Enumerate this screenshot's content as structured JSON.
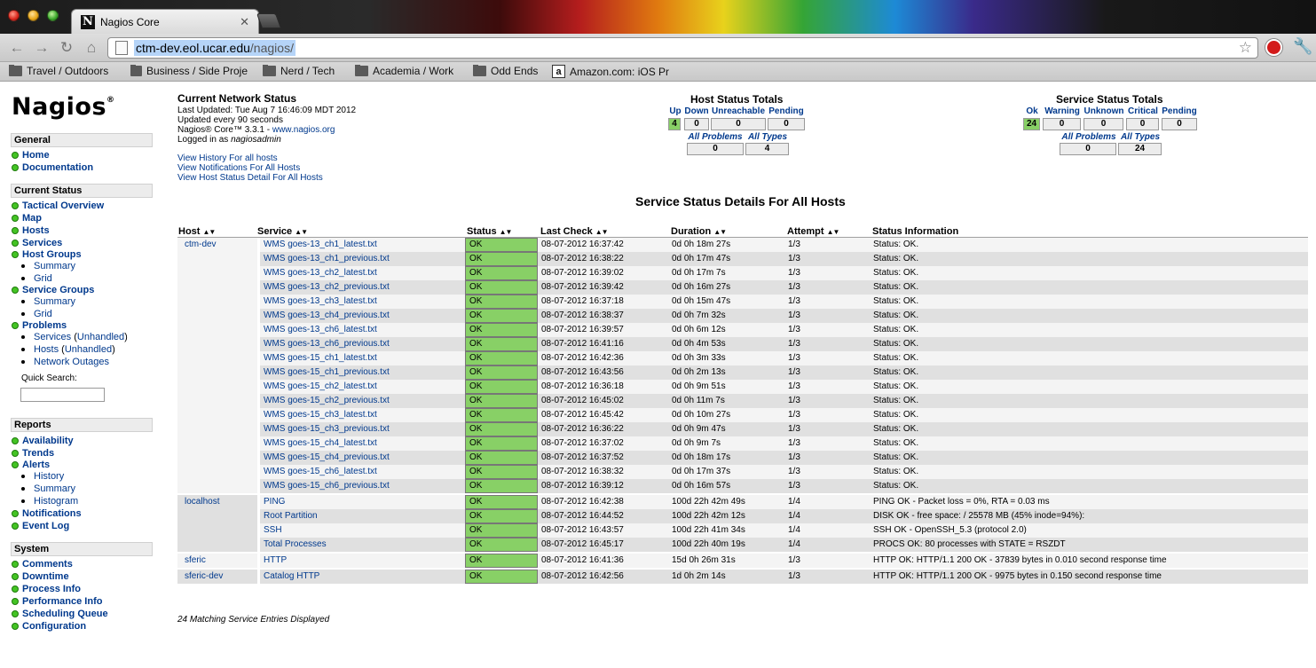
{
  "browser": {
    "tab_title": "Nagios Core",
    "tab_favicon": "N",
    "tab_close": "✕",
    "url_host": "ctm-dev.eol.ucar.edu",
    "url_path": "/nagios/",
    "bookmarks": [
      {
        "label": "Travel / Outdoors",
        "icon": "folder-icon"
      },
      {
        "label": "Business / Side Proje",
        "icon": "folder-icon"
      },
      {
        "label": "Nerd / Tech",
        "icon": "folder-icon"
      },
      {
        "label": "Academia / Work",
        "icon": "folder-icon"
      },
      {
        "label": "Odd Ends",
        "icon": "folder-icon"
      },
      {
        "label": "Amazon.com: iOS Pr",
        "icon": "amazon-icon"
      }
    ],
    "accent_colors": {
      "close": "#d8261c",
      "minimize": "#e6a414",
      "zoom": "#3aa62a"
    }
  },
  "logo": {
    "text": "Nagios",
    "mark": "®"
  },
  "sidebar": {
    "general": {
      "heading": "General",
      "items": [
        "Home",
        "Documentation"
      ]
    },
    "current_status": {
      "heading": "Current Status",
      "tactical": "Tactical Overview",
      "map": "Map",
      "hosts": "Hosts",
      "services": "Services",
      "host_groups": "Host Groups",
      "hg_summary": "Summary",
      "hg_grid": "Grid",
      "service_groups": "Service Groups",
      "sg_summary": "Summary",
      "sg_grid": "Grid",
      "problems": "Problems",
      "p_services": "Services",
      "p_services_unh": "Unhandled",
      "p_hosts": "Hosts",
      "p_hosts_unh": "Unhandled",
      "p_outages": "Network Outages",
      "quick_search": "Quick Search:"
    },
    "reports": {
      "heading": "Reports",
      "availability": "Availability",
      "trends": "Trends",
      "alerts": "Alerts",
      "a_history": "History",
      "a_summary": "Summary",
      "a_histogram": "Histogram",
      "notifications": "Notifications",
      "event_log": "Event Log"
    },
    "system": {
      "heading": "System",
      "items": [
        "Comments",
        "Downtime",
        "Process Info",
        "Performance Info",
        "Scheduling Queue",
        "Configuration"
      ]
    }
  },
  "network_status": {
    "title": "Current Network Status",
    "last_updated": "Last Updated: Tue Aug 7 16:46:09 MDT 2012",
    "interval": "Updated every 90 seconds",
    "version_prefix": "Nagios® Core™ 3.3.1 - ",
    "version_link": "www.nagios.org",
    "logged_prefix": "Logged in as ",
    "logged_user": "nagiosadmin",
    "links": [
      "View History For all hosts",
      "View Notifications For All Hosts",
      "View Host Status Detail For All Hosts"
    ]
  },
  "host_totals": {
    "title": "Host Status Totals",
    "headers": [
      "Up",
      "Down",
      "Unreachable",
      "Pending"
    ],
    "values": [
      "4",
      "0",
      "0",
      "0"
    ],
    "sub_headers": [
      "All Problems",
      "All Types"
    ],
    "sub_values": [
      "0",
      "4"
    ]
  },
  "service_totals": {
    "title": "Service Status Totals",
    "headers": [
      "Ok",
      "Warning",
      "Unknown",
      "Critical",
      "Pending"
    ],
    "values": [
      "24",
      "0",
      "0",
      "0",
      "0"
    ],
    "sub_headers": [
      "All Problems",
      "All Types"
    ],
    "sub_values": [
      "0",
      "24"
    ]
  },
  "service_details": {
    "title": "Service Status Details For All Hosts",
    "columns": [
      "Host",
      "Service",
      "Status",
      "Last Check",
      "Duration",
      "Attempt",
      "Status Information"
    ],
    "hosts": [
      "ctm-dev",
      "localhost",
      "sferic",
      "sferic-dev"
    ],
    "rows": [
      {
        "service": "WMS goes-13_ch1_latest.txt",
        "status": "OK",
        "last_check": "08-07-2012 16:37:42",
        "duration": "0d 0h 18m 27s",
        "attempt": "1/3",
        "info": "Status: OK."
      },
      {
        "service": "WMS goes-13_ch1_previous.txt",
        "status": "OK",
        "last_check": "08-07-2012 16:38:22",
        "duration": "0d 0h 17m 47s",
        "attempt": "1/3",
        "info": "Status: OK."
      },
      {
        "service": "WMS goes-13_ch2_latest.txt",
        "status": "OK",
        "last_check": "08-07-2012 16:39:02",
        "duration": "0d 0h 17m 7s",
        "attempt": "1/3",
        "info": "Status: OK."
      },
      {
        "service": "WMS goes-13_ch2_previous.txt",
        "status": "OK",
        "last_check": "08-07-2012 16:39:42",
        "duration": "0d 0h 16m 27s",
        "attempt": "1/3",
        "info": "Status: OK."
      },
      {
        "service": "WMS goes-13_ch3_latest.txt",
        "status": "OK",
        "last_check": "08-07-2012 16:37:18",
        "duration": "0d 0h 15m 47s",
        "attempt": "1/3",
        "info": "Status: OK."
      },
      {
        "service": "WMS goes-13_ch4_previous.txt",
        "status": "OK",
        "last_check": "08-07-2012 16:38:37",
        "duration": "0d 0h 7m 32s",
        "attempt": "1/3",
        "info": "Status: OK."
      },
      {
        "service": "WMS goes-13_ch6_latest.txt",
        "status": "OK",
        "last_check": "08-07-2012 16:39:57",
        "duration": "0d 0h 6m 12s",
        "attempt": "1/3",
        "info": "Status: OK."
      },
      {
        "service": "WMS goes-13_ch6_previous.txt",
        "status": "OK",
        "last_check": "08-07-2012 16:41:16",
        "duration": "0d 0h 4m 53s",
        "attempt": "1/3",
        "info": "Status: OK."
      },
      {
        "service": "WMS goes-15_ch1_latest.txt",
        "status": "OK",
        "last_check": "08-07-2012 16:42:36",
        "duration": "0d 0h 3m 33s",
        "attempt": "1/3",
        "info": "Status: OK."
      },
      {
        "service": "WMS goes-15_ch1_previous.txt",
        "status": "OK",
        "last_check": "08-07-2012 16:43:56",
        "duration": "0d 0h 2m 13s",
        "attempt": "1/3",
        "info": "Status: OK."
      },
      {
        "service": "WMS goes-15_ch2_latest.txt",
        "status": "OK",
        "last_check": "08-07-2012 16:36:18",
        "duration": "0d 0h 9m 51s",
        "attempt": "1/3",
        "info": "Status: OK."
      },
      {
        "service": "WMS goes-15_ch2_previous.txt",
        "status": "OK",
        "last_check": "08-07-2012 16:45:02",
        "duration": "0d 0h 11m 7s",
        "attempt": "1/3",
        "info": "Status: OK."
      },
      {
        "service": "WMS goes-15_ch3_latest.txt",
        "status": "OK",
        "last_check": "08-07-2012 16:45:42",
        "duration": "0d 0h 10m 27s",
        "attempt": "1/3",
        "info": "Status: OK."
      },
      {
        "service": "WMS goes-15_ch3_previous.txt",
        "status": "OK",
        "last_check": "08-07-2012 16:36:22",
        "duration": "0d 0h 9m 47s",
        "attempt": "1/3",
        "info": "Status: OK."
      },
      {
        "service": "WMS goes-15_ch4_latest.txt",
        "status": "OK",
        "last_check": "08-07-2012 16:37:02",
        "duration": "0d 0h 9m 7s",
        "attempt": "1/3",
        "info": "Status: OK."
      },
      {
        "service": "WMS goes-15_ch4_previous.txt",
        "status": "OK",
        "last_check": "08-07-2012 16:37:52",
        "duration": "0d 0h 18m 17s",
        "attempt": "1/3",
        "info": "Status: OK."
      },
      {
        "service": "WMS goes-15_ch6_latest.txt",
        "status": "OK",
        "last_check": "08-07-2012 16:38:32",
        "duration": "0d 0h 17m 37s",
        "attempt": "1/3",
        "info": "Status: OK."
      },
      {
        "service": "WMS goes-15_ch6_previous.txt",
        "status": "OK",
        "last_check": "08-07-2012 16:39:12",
        "duration": "0d 0h 16m 57s",
        "attempt": "1/3",
        "info": "Status: OK."
      },
      {
        "service": "PING",
        "status": "OK",
        "last_check": "08-07-2012 16:42:38",
        "duration": "100d 22h 42m 49s",
        "attempt": "1/4",
        "info": "PING OK - Packet loss = 0%, RTA = 0.03 ms"
      },
      {
        "service": "Root Partition",
        "status": "OK",
        "last_check": "08-07-2012 16:44:52",
        "duration": "100d 22h 42m 12s",
        "attempt": "1/4",
        "info": "DISK OK - free space: / 25578 MB (45% inode=94%):"
      },
      {
        "service": "SSH",
        "status": "OK",
        "last_check": "08-07-2012 16:43:57",
        "duration": "100d 22h 41m 34s",
        "attempt": "1/4",
        "info": "SSH OK - OpenSSH_5.3 (protocol 2.0)"
      },
      {
        "service": "Total Processes",
        "status": "OK",
        "last_check": "08-07-2012 16:45:17",
        "duration": "100d 22h 40m 19s",
        "attempt": "1/4",
        "info": "PROCS OK: 80 processes with STATE = RSZDT"
      },
      {
        "service": "HTTP",
        "status": "OK",
        "last_check": "08-07-2012 16:41:36",
        "duration": "15d 0h 26m 31s",
        "attempt": "1/3",
        "info": "HTTP OK: HTTP/1.1 200 OK - 37839 bytes in 0.010 second response time"
      },
      {
        "service": "Catalog HTTP",
        "status": "OK",
        "last_check": "08-07-2012 16:42:56",
        "duration": "1d 0h 2m 14s",
        "attempt": "1/3",
        "info": "HTTP OK: HTTP/1.1 200 OK - 9975 bytes in 0.150 second response time"
      }
    ],
    "footer": "24 Matching Service Entries Displayed",
    "status_colors": {
      "ok": "#88d066"
    }
  }
}
